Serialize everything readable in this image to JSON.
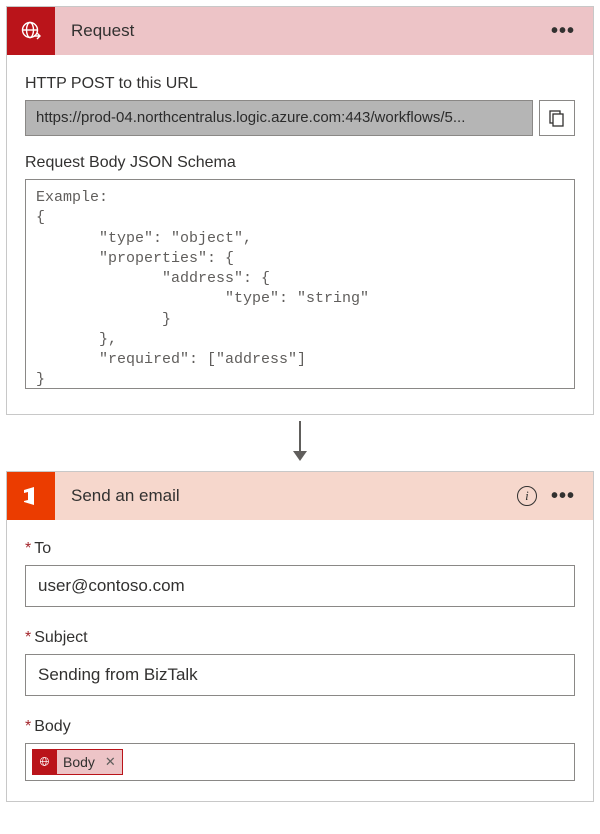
{
  "request": {
    "title": "Request",
    "url_label": "HTTP POST to this URL",
    "url_value": "https://prod-04.northcentralus.logic.azure.com:443/workflows/5...",
    "schema_label": "Request Body JSON Schema",
    "schema_value": "Example:\n{\n       \"type\": \"object\",\n       \"properties\": {\n              \"address\": {\n                     \"type\": \"string\"\n              }\n       },\n       \"required\": [\"address\"]\n}"
  },
  "email": {
    "title": "Send an email",
    "to_label": "To",
    "to_value": "user@contoso.com",
    "subject_label": "Subject",
    "subject_value": "Sending from BizTalk",
    "body_label": "Body",
    "body_chip": "Body"
  }
}
